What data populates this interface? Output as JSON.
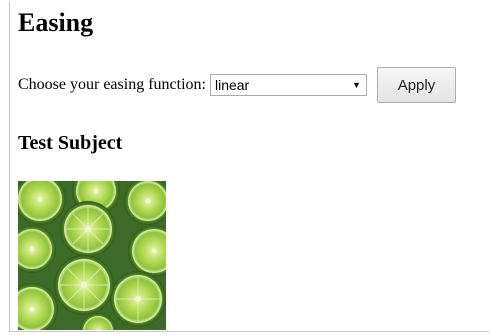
{
  "page": {
    "title": "Easing"
  },
  "controls": {
    "label": "Choose your easing function:",
    "select_value": "linear",
    "apply_label": "Apply"
  },
  "subject": {
    "heading": "Test Subject"
  },
  "icons": {
    "select_arrow": "dropdown-arrow-icon"
  }
}
